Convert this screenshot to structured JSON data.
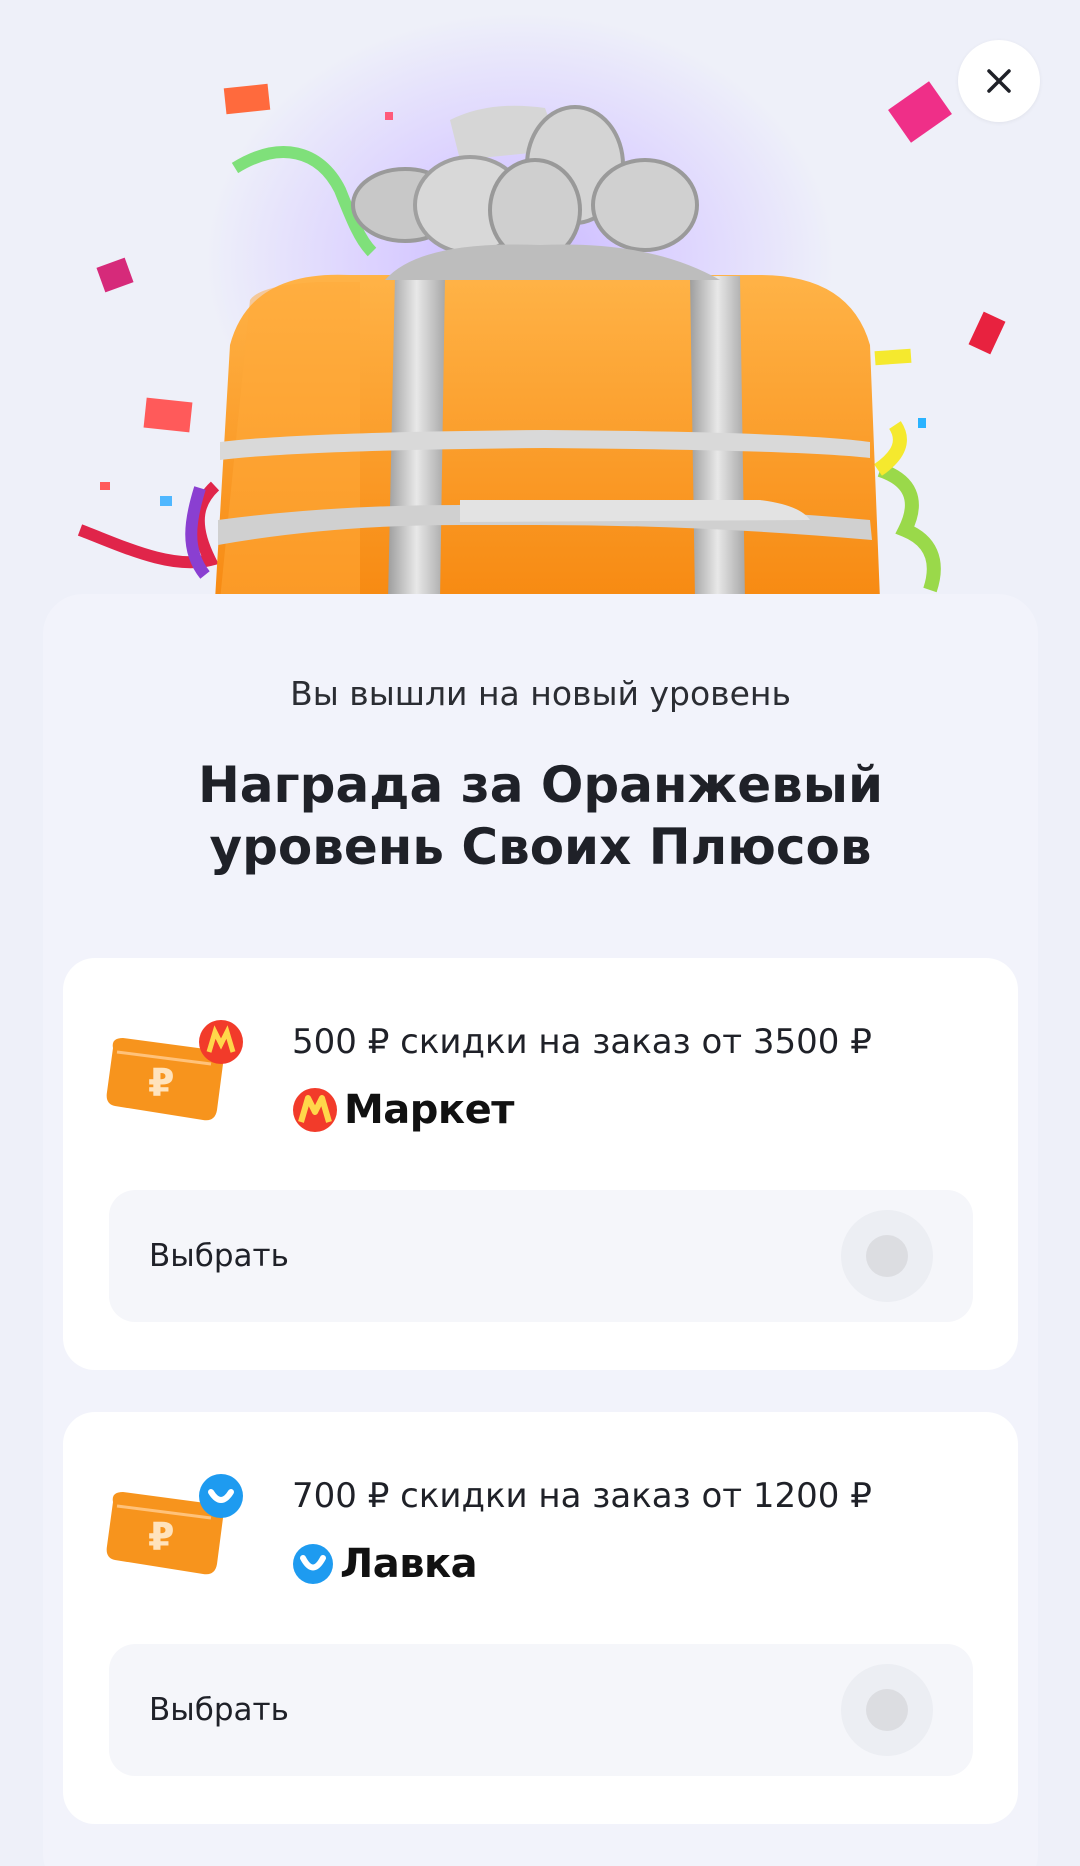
{
  "header": {
    "close_icon": "close-icon",
    "illustration": "gift-box-with-bow-and-confetti"
  },
  "main": {
    "subtitle": "Вы вышли на новый уровень",
    "title": "Награда за Оранжевый уровень Своих Плюсов"
  },
  "rewards": [
    {
      "description": "500 ₽ скидки на заказ от 3500 ₽",
      "brand": "Маркет",
      "brand_icon": "market-logo-icon",
      "select_label": "Выбрать",
      "selected": false
    },
    {
      "description": "700 ₽ скидки на заказ от 1200 ₽",
      "brand": "Лавка",
      "brand_icon": "lavka-logo-icon",
      "select_label": "Выбрать",
      "selected": false
    }
  ],
  "colors": {
    "accent_orange": "#f7941d",
    "market_red": "#f23b2a",
    "lavka_blue": "#1e9bf0"
  }
}
